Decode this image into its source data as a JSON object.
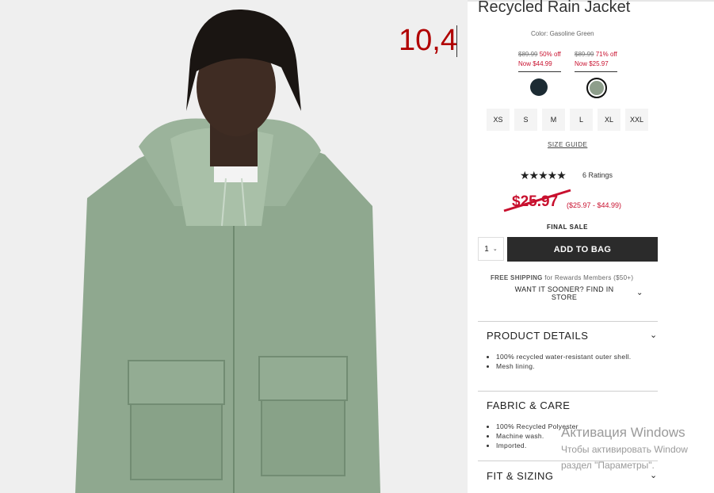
{
  "annotation": {
    "text": "10,4"
  },
  "product": {
    "title": "Recycled Rain Jacket",
    "color_label": "Color: Gasoline Green",
    "price_options": [
      {
        "old": "$89.99",
        "discount": "50% off",
        "now": "Now $44.99",
        "swatch": "#1c2b33"
      },
      {
        "old": "$89.99",
        "discount": "71% off",
        "now": "Now $25.97",
        "swatch": "#8e9e8b"
      }
    ],
    "sizes": [
      "XS",
      "S",
      "M",
      "L",
      "XL",
      "XXL"
    ],
    "size_guide": "SIZE GUIDE",
    "rating_stars": "★★★★★",
    "ratings_count": "6 Ratings",
    "price": "$25.97",
    "price_range": "($25.97 - $44.99)",
    "final_sale": "FINAL SALE",
    "quantity": "1",
    "add_to_bag": "ADD TO BAG",
    "shipping_bold": "FREE SHIPPING",
    "shipping_rest": " for Rewards Members ($50+)",
    "store_pickup": "WANT IT SOONER? FIND IN STORE"
  },
  "sections": {
    "details": {
      "title": "PRODUCT DETAILS",
      "items": [
        "100% recycled water-resistant outer shell.",
        "Mesh lining."
      ]
    },
    "fabric": {
      "title": "FABRIC & CARE",
      "items": [
        "100% Recycled Polyester",
        "Machine wash.",
        "Imported."
      ]
    },
    "fit": {
      "title": "FIT & SIZING"
    }
  },
  "watermark": {
    "line1": "Активация Windows",
    "line2": "Чтобы активировать Window",
    "line3": "раздел \"Параметры\"."
  },
  "colors": {
    "sale_red": "#c8102e",
    "jacket": "#8ea78f",
    "button_dark": "#2b2b2b"
  }
}
